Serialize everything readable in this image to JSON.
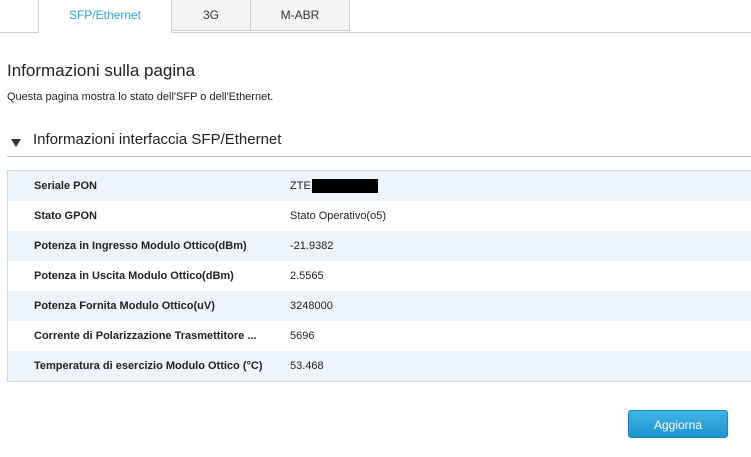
{
  "tabs": [
    {
      "label": "SFP/Ethernet",
      "active": true
    },
    {
      "label": "3G",
      "active": false
    },
    {
      "label": "M-ABR",
      "active": false
    }
  ],
  "page": {
    "title": "Informazioni sulla pagina",
    "description": "Questa pagina mostra lo stato dell'SFP o dell'Ethernet."
  },
  "section": {
    "title": "Informazioni interfaccia SFP/Ethernet",
    "rows": [
      {
        "label": "Seriale PON",
        "value": "ZTE"
      },
      {
        "label": "Stato GPON",
        "value": "Stato Operativo(o5)"
      },
      {
        "label": "Potenza in Ingresso Modulo Ottico(dBm)",
        "value": "-21.9382"
      },
      {
        "label": "Potenza in Uscita Modulo Ottico(dBm)",
        "value": "2.5565"
      },
      {
        "label": "Potenza Fornita Modulo Ottico(uV)",
        "value": "3248000"
      },
      {
        "label": "Corrente di Polarizzazione Trasmettitore ...",
        "value": "5696"
      },
      {
        "label": "Temperatura di esercizio Modulo Ottico (°C)",
        "value": "53.468"
      }
    ]
  },
  "buttons": {
    "refresh_label": "Aggiorna"
  },
  "colors": {
    "accent": "#2aa3d6",
    "row_alt": "#eef4fb",
    "button": "#1d93cf"
  }
}
